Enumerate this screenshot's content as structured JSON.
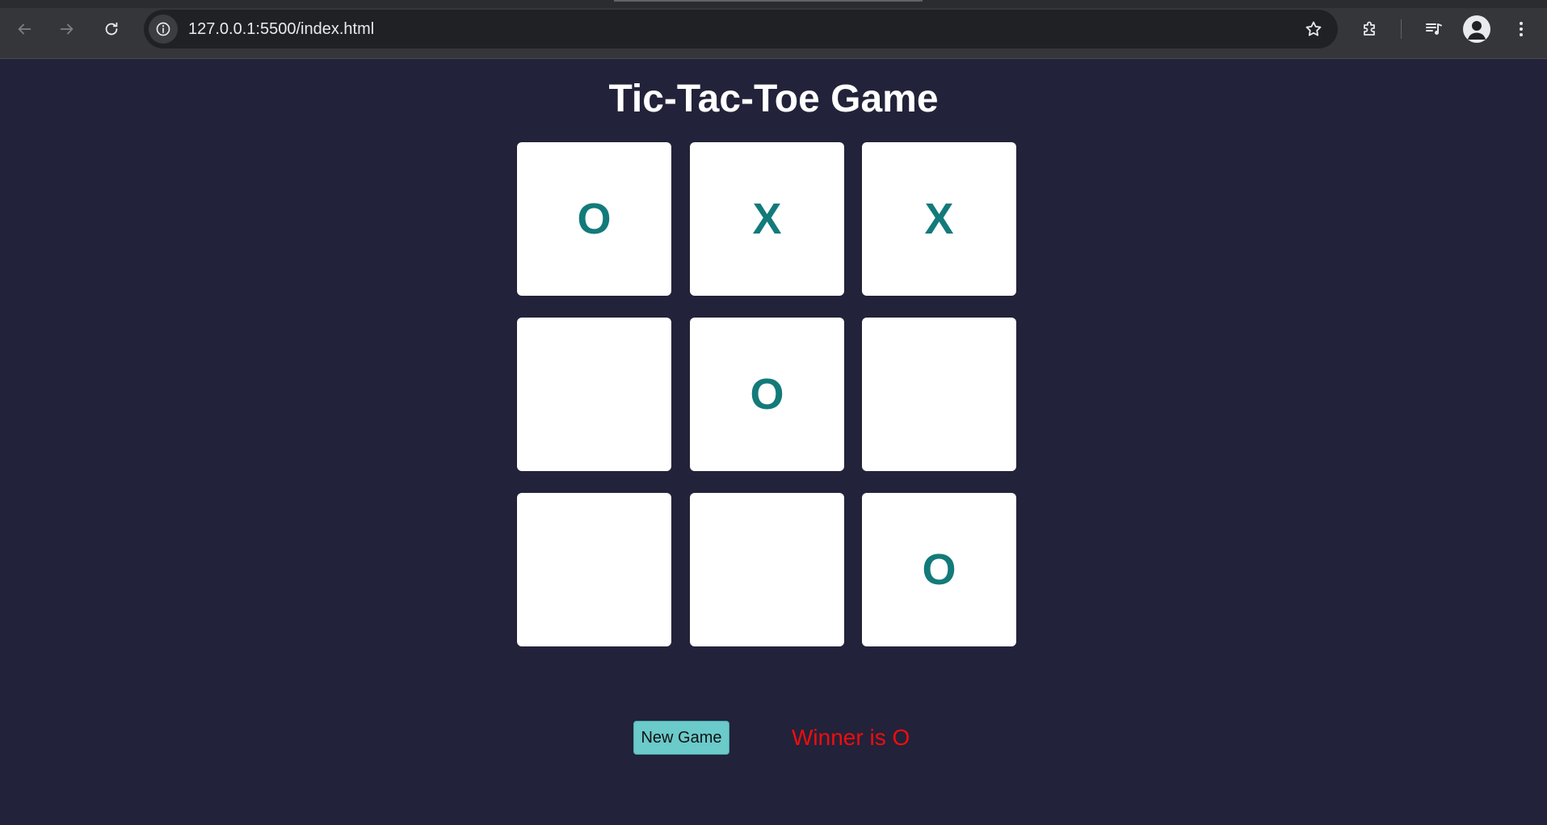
{
  "browser": {
    "url": "127.0.0.1:5500/index.html",
    "icons": {
      "back": "arrow-left-icon",
      "forward": "arrow-right-icon",
      "reload": "reload-icon",
      "site_info": "info-icon",
      "bookmark": "star-icon",
      "extensions": "puzzle-icon",
      "media": "media-controls-icon",
      "profile": "person-icon",
      "menu": "kebab-menu-icon"
    }
  },
  "page": {
    "title": "Tic-Tac-Toe Game",
    "board": {
      "cells": [
        "O",
        "X",
        "X",
        "",
        "O",
        "",
        "",
        "",
        "O"
      ]
    },
    "new_game_label": "New Game",
    "status": "Winner is O"
  },
  "colors": {
    "background": "#22223a",
    "cell_background": "#ffffff",
    "mark": "#137a7a",
    "button": "#6bcaca",
    "winner_text": "#f20d0d"
  }
}
